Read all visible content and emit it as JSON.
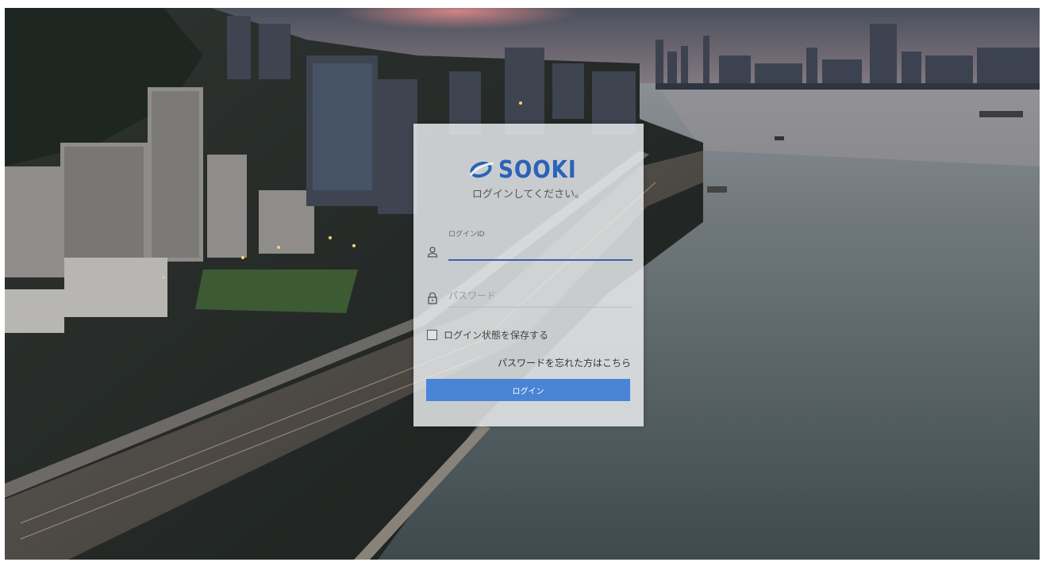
{
  "brand": {
    "name": "SOOKI",
    "color": "#2a63b8"
  },
  "login": {
    "subtitle": "ログインしてください。",
    "login_id_label": "ログインID",
    "login_id_value": "",
    "password_placeholder": "パスワード",
    "remember_label": "ログイン状態を保存する",
    "remember_checked": false,
    "forgot_link": "パスワードを忘れた方はこちら",
    "submit_label": "ログイン"
  },
  "icons": {
    "logo": "sooki-swoosh-icon",
    "user": "user-icon",
    "lock": "lock-icon",
    "checkbox": "checkbox"
  },
  "colors": {
    "accent": "#4a84d4",
    "focus_underline": "#3a5fb0"
  }
}
